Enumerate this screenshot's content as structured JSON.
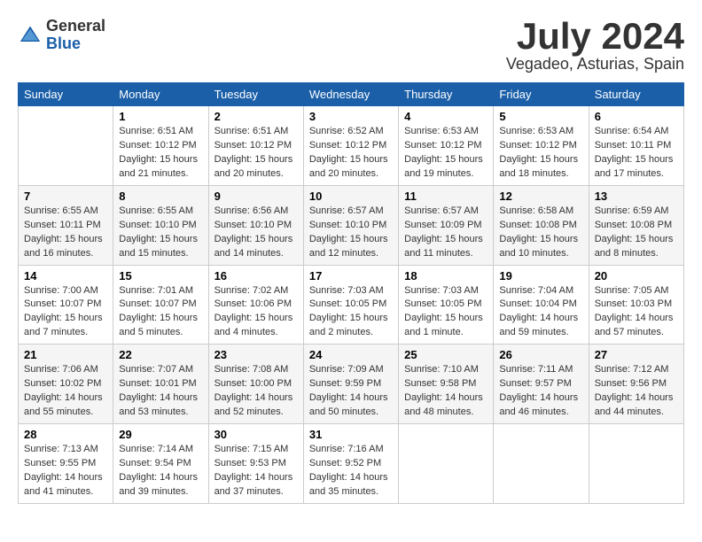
{
  "logo": {
    "general": "General",
    "blue": "Blue"
  },
  "title": "July 2024",
  "subtitle": "Vegadeo, Asturias, Spain",
  "header_days": [
    "Sunday",
    "Monday",
    "Tuesday",
    "Wednesday",
    "Thursday",
    "Friday",
    "Saturday"
  ],
  "weeks": [
    [
      {
        "day": "",
        "info": ""
      },
      {
        "day": "1",
        "info": "Sunrise: 6:51 AM\nSunset: 10:12 PM\nDaylight: 15 hours\nand 21 minutes."
      },
      {
        "day": "2",
        "info": "Sunrise: 6:51 AM\nSunset: 10:12 PM\nDaylight: 15 hours\nand 20 minutes."
      },
      {
        "day": "3",
        "info": "Sunrise: 6:52 AM\nSunset: 10:12 PM\nDaylight: 15 hours\nand 20 minutes."
      },
      {
        "day": "4",
        "info": "Sunrise: 6:53 AM\nSunset: 10:12 PM\nDaylight: 15 hours\nand 19 minutes."
      },
      {
        "day": "5",
        "info": "Sunrise: 6:53 AM\nSunset: 10:12 PM\nDaylight: 15 hours\nand 18 minutes."
      },
      {
        "day": "6",
        "info": "Sunrise: 6:54 AM\nSunset: 10:11 PM\nDaylight: 15 hours\nand 17 minutes."
      }
    ],
    [
      {
        "day": "7",
        "info": "Sunrise: 6:55 AM\nSunset: 10:11 PM\nDaylight: 15 hours\nand 16 minutes."
      },
      {
        "day": "8",
        "info": "Sunrise: 6:55 AM\nSunset: 10:10 PM\nDaylight: 15 hours\nand 15 minutes."
      },
      {
        "day": "9",
        "info": "Sunrise: 6:56 AM\nSunset: 10:10 PM\nDaylight: 15 hours\nand 14 minutes."
      },
      {
        "day": "10",
        "info": "Sunrise: 6:57 AM\nSunset: 10:10 PM\nDaylight: 15 hours\nand 12 minutes."
      },
      {
        "day": "11",
        "info": "Sunrise: 6:57 AM\nSunset: 10:09 PM\nDaylight: 15 hours\nand 11 minutes."
      },
      {
        "day": "12",
        "info": "Sunrise: 6:58 AM\nSunset: 10:08 PM\nDaylight: 15 hours\nand 10 minutes."
      },
      {
        "day": "13",
        "info": "Sunrise: 6:59 AM\nSunset: 10:08 PM\nDaylight: 15 hours\nand 8 minutes."
      }
    ],
    [
      {
        "day": "14",
        "info": "Sunrise: 7:00 AM\nSunset: 10:07 PM\nDaylight: 15 hours\nand 7 minutes."
      },
      {
        "day": "15",
        "info": "Sunrise: 7:01 AM\nSunset: 10:07 PM\nDaylight: 15 hours\nand 5 minutes."
      },
      {
        "day": "16",
        "info": "Sunrise: 7:02 AM\nSunset: 10:06 PM\nDaylight: 15 hours\nand 4 minutes."
      },
      {
        "day": "17",
        "info": "Sunrise: 7:03 AM\nSunset: 10:05 PM\nDaylight: 15 hours\nand 2 minutes."
      },
      {
        "day": "18",
        "info": "Sunrise: 7:03 AM\nSunset: 10:05 PM\nDaylight: 15 hours\nand 1 minute."
      },
      {
        "day": "19",
        "info": "Sunrise: 7:04 AM\nSunset: 10:04 PM\nDaylight: 14 hours\nand 59 minutes."
      },
      {
        "day": "20",
        "info": "Sunrise: 7:05 AM\nSunset: 10:03 PM\nDaylight: 14 hours\nand 57 minutes."
      }
    ],
    [
      {
        "day": "21",
        "info": "Sunrise: 7:06 AM\nSunset: 10:02 PM\nDaylight: 14 hours\nand 55 minutes."
      },
      {
        "day": "22",
        "info": "Sunrise: 7:07 AM\nSunset: 10:01 PM\nDaylight: 14 hours\nand 53 minutes."
      },
      {
        "day": "23",
        "info": "Sunrise: 7:08 AM\nSunset: 10:00 PM\nDaylight: 14 hours\nand 52 minutes."
      },
      {
        "day": "24",
        "info": "Sunrise: 7:09 AM\nSunset: 9:59 PM\nDaylight: 14 hours\nand 50 minutes."
      },
      {
        "day": "25",
        "info": "Sunrise: 7:10 AM\nSunset: 9:58 PM\nDaylight: 14 hours\nand 48 minutes."
      },
      {
        "day": "26",
        "info": "Sunrise: 7:11 AM\nSunset: 9:57 PM\nDaylight: 14 hours\nand 46 minutes."
      },
      {
        "day": "27",
        "info": "Sunrise: 7:12 AM\nSunset: 9:56 PM\nDaylight: 14 hours\nand 44 minutes."
      }
    ],
    [
      {
        "day": "28",
        "info": "Sunrise: 7:13 AM\nSunset: 9:55 PM\nDaylight: 14 hours\nand 41 minutes."
      },
      {
        "day": "29",
        "info": "Sunrise: 7:14 AM\nSunset: 9:54 PM\nDaylight: 14 hours\nand 39 minutes."
      },
      {
        "day": "30",
        "info": "Sunrise: 7:15 AM\nSunset: 9:53 PM\nDaylight: 14 hours\nand 37 minutes."
      },
      {
        "day": "31",
        "info": "Sunrise: 7:16 AM\nSunset: 9:52 PM\nDaylight: 14 hours\nand 35 minutes."
      },
      {
        "day": "",
        "info": ""
      },
      {
        "day": "",
        "info": ""
      },
      {
        "day": "",
        "info": ""
      }
    ]
  ]
}
